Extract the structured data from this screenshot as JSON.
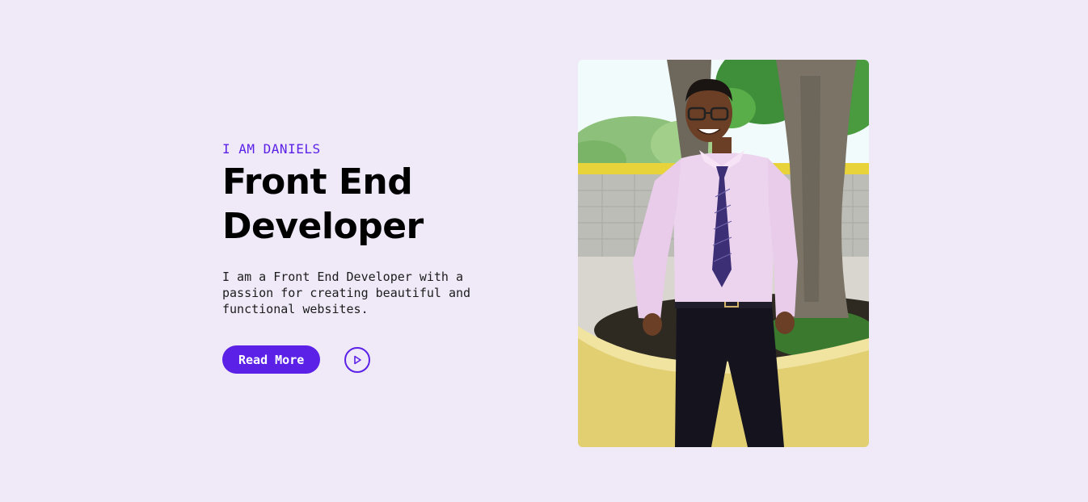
{
  "hero": {
    "eyebrow": "I AM DANIELS",
    "headline_line1": "Front End",
    "headline_line2": "Developer",
    "description": "I am a Front End Developer with a passion for creating beautiful and functional websites.",
    "read_more_label": "Read More",
    "play_icon": "play-circle-icon"
  },
  "theme": {
    "background": "#EFE9F8",
    "accent": "#5B21E6",
    "eyebrow_color": "#5B21E6",
    "heading_color": "#000000"
  }
}
